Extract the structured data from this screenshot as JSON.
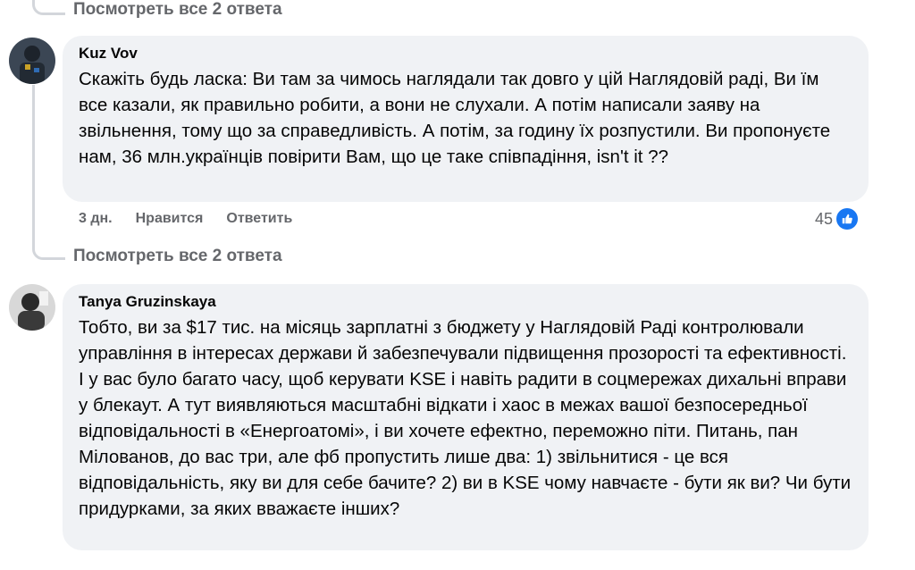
{
  "thread": {
    "view_replies_top": "Посмотреть все 2 ответа",
    "view_replies_mid": "Посмотреть все 2 ответа"
  },
  "comments": [
    {
      "author": "Kuz Vov",
      "text": "Скажіть будь ласка: Ви там за чимось наглядали так довго у цій Наглядовій раді, Ви їм все казали, як правильно робити, а вони не слухали. А потім написали заяву на звільнення, тому що за справедливість. А потім, за годину їх розпустили. Ви пропонуєте нам, 36 млн.українців повірити Вам, що це таке співпадіння, isn't it ??",
      "time": "3 дн.",
      "like_label": "Нравится",
      "reply_label": "Ответить",
      "reactions_count": "45"
    },
    {
      "author": "Tanya Gruzinskaya",
      "text": "Тобто, ви за $17 тис. на місяць зарплатні з бюджету у Наглядовій Раді контролювали управління в інтересах держави й забезпечували підвищення прозорості та ефективності. І у вас було багато часу, щоб керувати KSE і навіть радити в соцмережах дихальні вправи у блекаут. А тут виявляються масштабні відкати і хаос в межах вашої безпосередньої відповідальності в «Енергоатомі», і ви хочете ефектно, переможно піти. Питань, пан Мілованов, до вас три, але фб пропустить лише два: 1) звільнитися - це вся відповідальність, яку ви для себе бачите? 2) ви в KSE чому навчаєте - бути як ви? Чи бути придурками, за яких вважаєте інших?"
    }
  ],
  "icons": {
    "like": "like-icon",
    "avatar1": "avatar-photo",
    "avatar2": "avatar-photo"
  },
  "colors": {
    "bubble": "#f0f2f5",
    "secondary_text": "#65676b",
    "like_blue": "#1877f2"
  }
}
